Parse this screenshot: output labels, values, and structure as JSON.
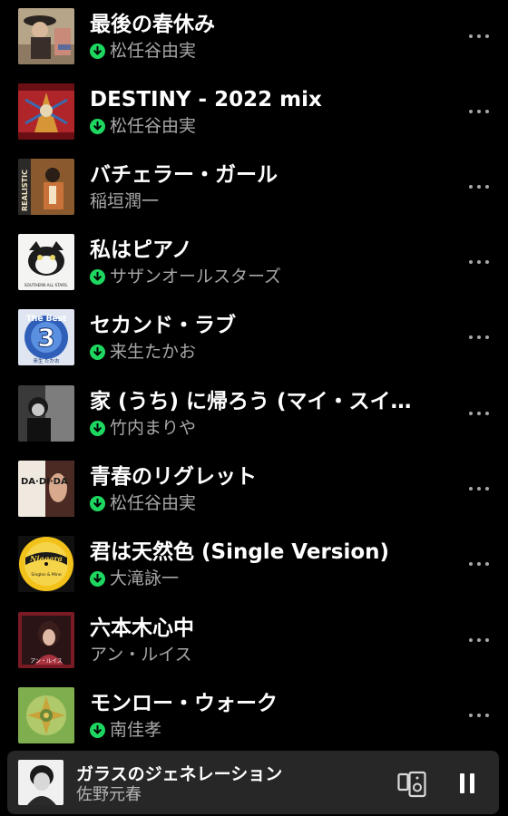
{
  "tracks": [
    {
      "title": "最後の春休み",
      "artist": "松任谷由実",
      "downloaded": true,
      "art_icon": "album-art"
    },
    {
      "title": "DESTINY - 2022 mix",
      "artist": "松任谷由実",
      "downloaded": true,
      "art_icon": "album-art"
    },
    {
      "title": "バチェラー・ガール",
      "artist": "稲垣潤一",
      "downloaded": false,
      "art_icon": "album-art",
      "art_text": "REALISTIC"
    },
    {
      "title": "私はピアノ",
      "artist": "サザンオールスターズ",
      "downloaded": true,
      "art_icon": "album-art",
      "art_text": "SOUTHERN ALL STARS."
    },
    {
      "title": "セカンド・ラブ",
      "artist": "来生たかお",
      "downloaded": true,
      "art_icon": "album-art",
      "art_text": "The Best",
      "art_number": "3",
      "art_sub": "来生 たかお"
    },
    {
      "title": "家 (うち) に帰ろう (マイ・スイ…",
      "artist": "竹内まりや",
      "downloaded": true,
      "art_icon": "album-art"
    },
    {
      "title": "青春のリグレット",
      "artist": "松任谷由実",
      "downloaded": true,
      "art_icon": "album-art",
      "art_text": "DA·DI·DA"
    },
    {
      "title": "君は天然色 (Single Version)",
      "artist": "大滝詠一",
      "downloaded": true,
      "art_icon": "album-art",
      "art_text": "Niagara",
      "art_sub": "Singles & Mine"
    },
    {
      "title": "六本木心中",
      "artist": "アン・ルイス",
      "downloaded": false,
      "art_icon": "album-art",
      "art_text": "アン・ルイス"
    },
    {
      "title": "モンロー・ウォーク",
      "artist": "南佳孝",
      "downloaded": true,
      "art_icon": "album-art"
    }
  ],
  "now_playing": {
    "title": "ガラスのジェネレーション",
    "artist": "佐野元春"
  },
  "icons": {
    "download": "download-icon",
    "more": "more-options-icon",
    "device": "connect-device-icon",
    "pause": "pause-icon"
  },
  "colors": {
    "background": "#000000",
    "accent_green": "#1ed760",
    "secondary_text": "#a7a7a7",
    "player_bg": "#272727"
  }
}
